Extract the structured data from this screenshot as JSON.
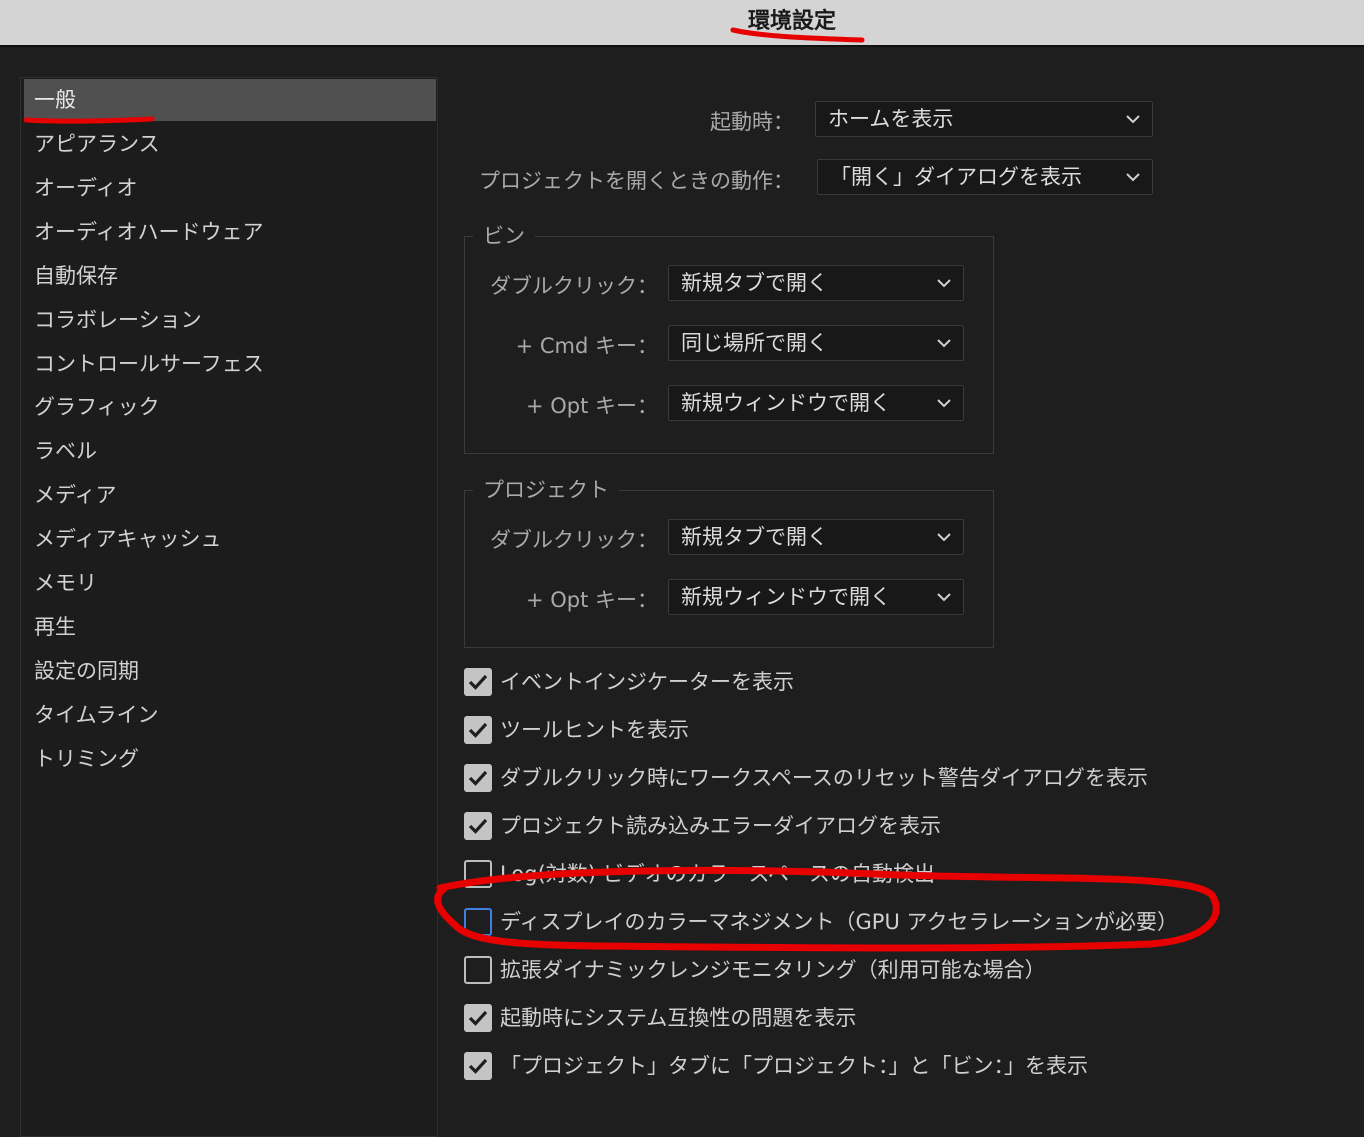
{
  "window": {
    "title": "環境設定"
  },
  "sidebar": {
    "items": [
      {
        "label": "一般",
        "selected": true
      },
      {
        "label": "アピアランス"
      },
      {
        "label": "オーディオ"
      },
      {
        "label": "オーディオハードウェア"
      },
      {
        "label": "自動保存"
      },
      {
        "label": "コラボレーション"
      },
      {
        "label": "コントロールサーフェス"
      },
      {
        "label": "グラフィック"
      },
      {
        "label": "ラベル"
      },
      {
        "label": "メディア"
      },
      {
        "label": "メディアキャッシュ"
      },
      {
        "label": "メモリ"
      },
      {
        "label": "再生"
      },
      {
        "label": "設定の同期"
      },
      {
        "label": "タイムライン"
      },
      {
        "label": "トリミング"
      }
    ]
  },
  "general": {
    "startup_label": "起動時：",
    "startup_value": "ホームを表示",
    "open_project_label": "プロジェクトを開くときの動作：",
    "open_project_value": "「開く」ダイアログを表示"
  },
  "bin": {
    "title": "ビン",
    "double_click_label": "ダブルクリック：",
    "double_click_value": "新規タブで開く",
    "cmd_label": "+ Cmd キー：",
    "cmd_value": "同じ場所で開く",
    "opt_label": "+ Opt キー：",
    "opt_value": "新規ウィンドウで開く"
  },
  "project": {
    "title": "プロジェクト",
    "double_click_label": "ダブルクリック：",
    "double_click_value": "新規タブで開く",
    "opt_label": "+ Opt キー：",
    "opt_value": "新規ウィンドウで開く"
  },
  "checkboxes": [
    {
      "label": "イベントインジケーターを表示",
      "checked": true
    },
    {
      "label": "ツールヒントを表示",
      "checked": true
    },
    {
      "label": "ダブルクリック時にワークスペースのリセット警告ダイアログを表示",
      "checked": true
    },
    {
      "label": "プロジェクト読み込みエラーダイアログを表示",
      "checked": true
    },
    {
      "label": "Log(対数) ビデオのカラースペースの自動検出",
      "checked": false
    },
    {
      "label": "ディスプレイのカラーマネジメント（GPU アクセラレーションが必要）",
      "checked": false,
      "focused": true
    },
    {
      "label": "拡張ダイナミックレンジモニタリング（利用可能な場合）",
      "checked": false
    },
    {
      "label": "起動時にシステム互換性の問題を表示",
      "checked": true
    },
    {
      "label": "「プロジェクト」タブに「プロジェクト：」と「ビン：」を表示",
      "checked": true
    }
  ],
  "colors": {
    "annotation": "#e60000",
    "focus": "#3f7fe0",
    "selected_bg": "#505050"
  }
}
